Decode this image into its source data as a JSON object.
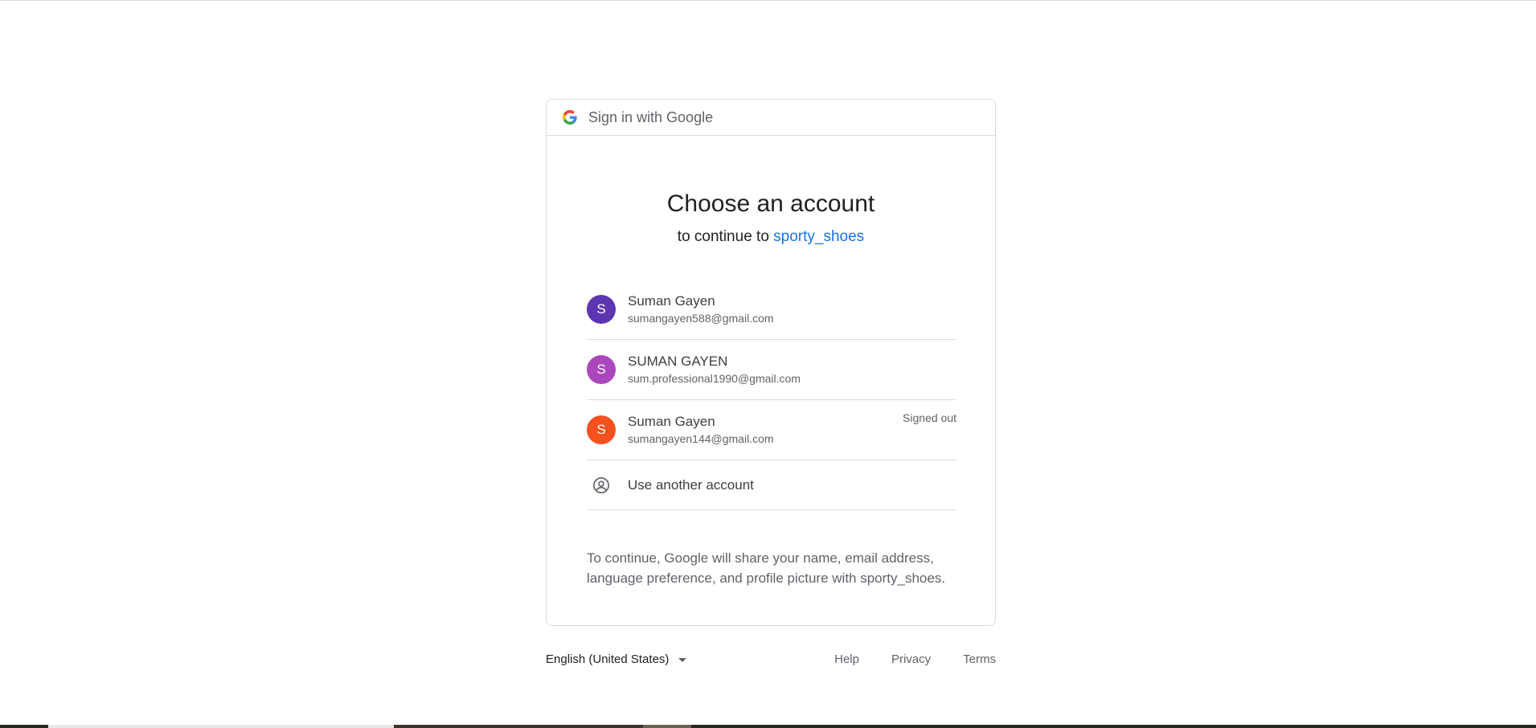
{
  "header": {
    "title": "Sign in with Google"
  },
  "main": {
    "heading": "Choose an account",
    "subheading_prefix": "to continue to ",
    "app_name": "sporty_shoes"
  },
  "accounts": [
    {
      "initial": "S",
      "name": "Suman Gayen",
      "email": "sumangayen588@gmail.com",
      "status": "",
      "color": "#5e35b1"
    },
    {
      "initial": "S",
      "name": "SUMAN GAYEN",
      "email": "sum.professional1990@gmail.com",
      "status": "",
      "color": "#ab47bc"
    },
    {
      "initial": "S",
      "name": "Suman Gayen",
      "email": "sumangayen144@gmail.com",
      "status": "Signed out",
      "color": "#f4511e"
    }
  ],
  "use_another": {
    "label": "Use another account",
    "icon": "person-circle-icon"
  },
  "disclaimer": "To continue, Google will share your name, email address, language preference, and profile picture with sporty_shoes.",
  "footer": {
    "language": "English (United States)",
    "links": [
      "Help",
      "Privacy",
      "Terms"
    ]
  },
  "colors": {
    "link_blue": "#1a73e8",
    "border": "#dadce0",
    "text_secondary": "#5f6368"
  }
}
